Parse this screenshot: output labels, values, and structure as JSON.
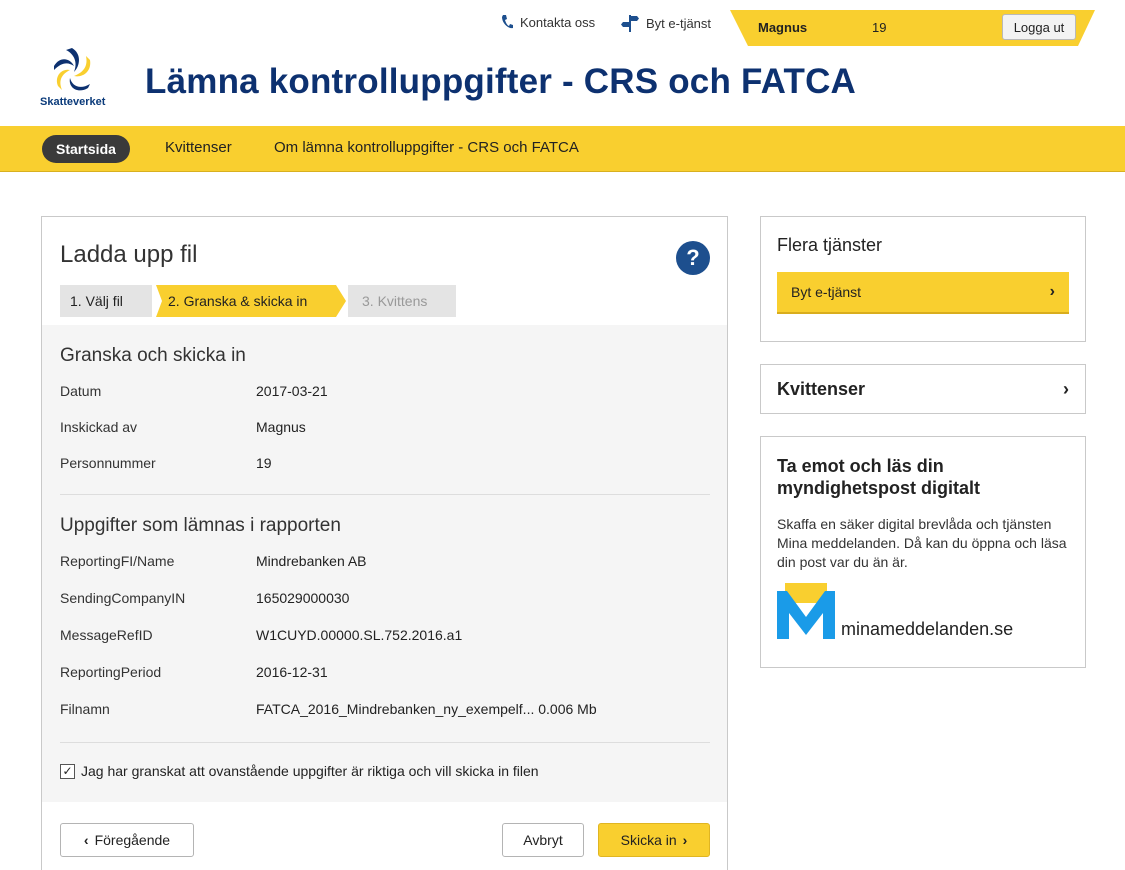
{
  "header": {
    "contact_label": "Kontakta oss",
    "switch_label": "Byt e-tjänst",
    "user_name": "Magnus",
    "user_pnr": "19",
    "logout_label": "Logga ut",
    "logo_text": "Skatteverket",
    "app_title": "Lämna kontrolluppgifter - CRS och FATCA"
  },
  "nav": {
    "items": [
      "Startsida",
      "Kvittenser",
      "Om lämna kontrolluppgifter - CRS och FATCA"
    ]
  },
  "main": {
    "title": "Ladda upp fil",
    "help_label": "?",
    "steps": [
      "1.  Välj fil",
      "2. Granska & skicka in",
      "3. Kvittens"
    ],
    "review_title": "Granska och skicka in",
    "review_rows": [
      {
        "label": "Datum",
        "value": "2017-03-21"
      },
      {
        "label": "Inskickad av",
        "value": "Magnus"
      },
      {
        "label": "Personnummer",
        "value": "19"
      }
    ],
    "report_title": "Uppgifter som lämnas i rapporten",
    "report_rows": [
      {
        "label": "ReportingFI/Name",
        "value": "Mindrebanken AB"
      },
      {
        "label": "SendingCompanyIN",
        "value": "165029000030"
      },
      {
        "label": "MessageRefID",
        "value": "W1CUYD.00000.SL.752.2016.a1"
      },
      {
        "label": "ReportingPeriod",
        "value": "2016-12-31"
      },
      {
        "label": "Filnamn",
        "value": "FATCA_2016_Mindrebanken_ny_exempelf... 0.006 Mb"
      }
    ],
    "confirm_label": "Jag har granskat att ovanstående uppgifter är riktiga och vill skicka in filen",
    "prev_label": "Föregående",
    "cancel_label": "Avbryt",
    "send_label": "Skicka in"
  },
  "sidebar": {
    "services_title": "Flera tjänster",
    "services_button": "Byt e-tjänst",
    "receipts_title": "Kvittenser",
    "mail_title": "Ta emot och läs din myndighetspost digitalt",
    "mail_text": "Skaffa en säker digital brevlåda och tjänsten Mina meddelanden. Då kan du öppna och läsa din post var du än är.",
    "mail_brand": "minameddelanden.se"
  },
  "colors": {
    "yellow": "#f9cf2f",
    "navy": "#0d3170",
    "help_blue": "#1d4f8e"
  }
}
